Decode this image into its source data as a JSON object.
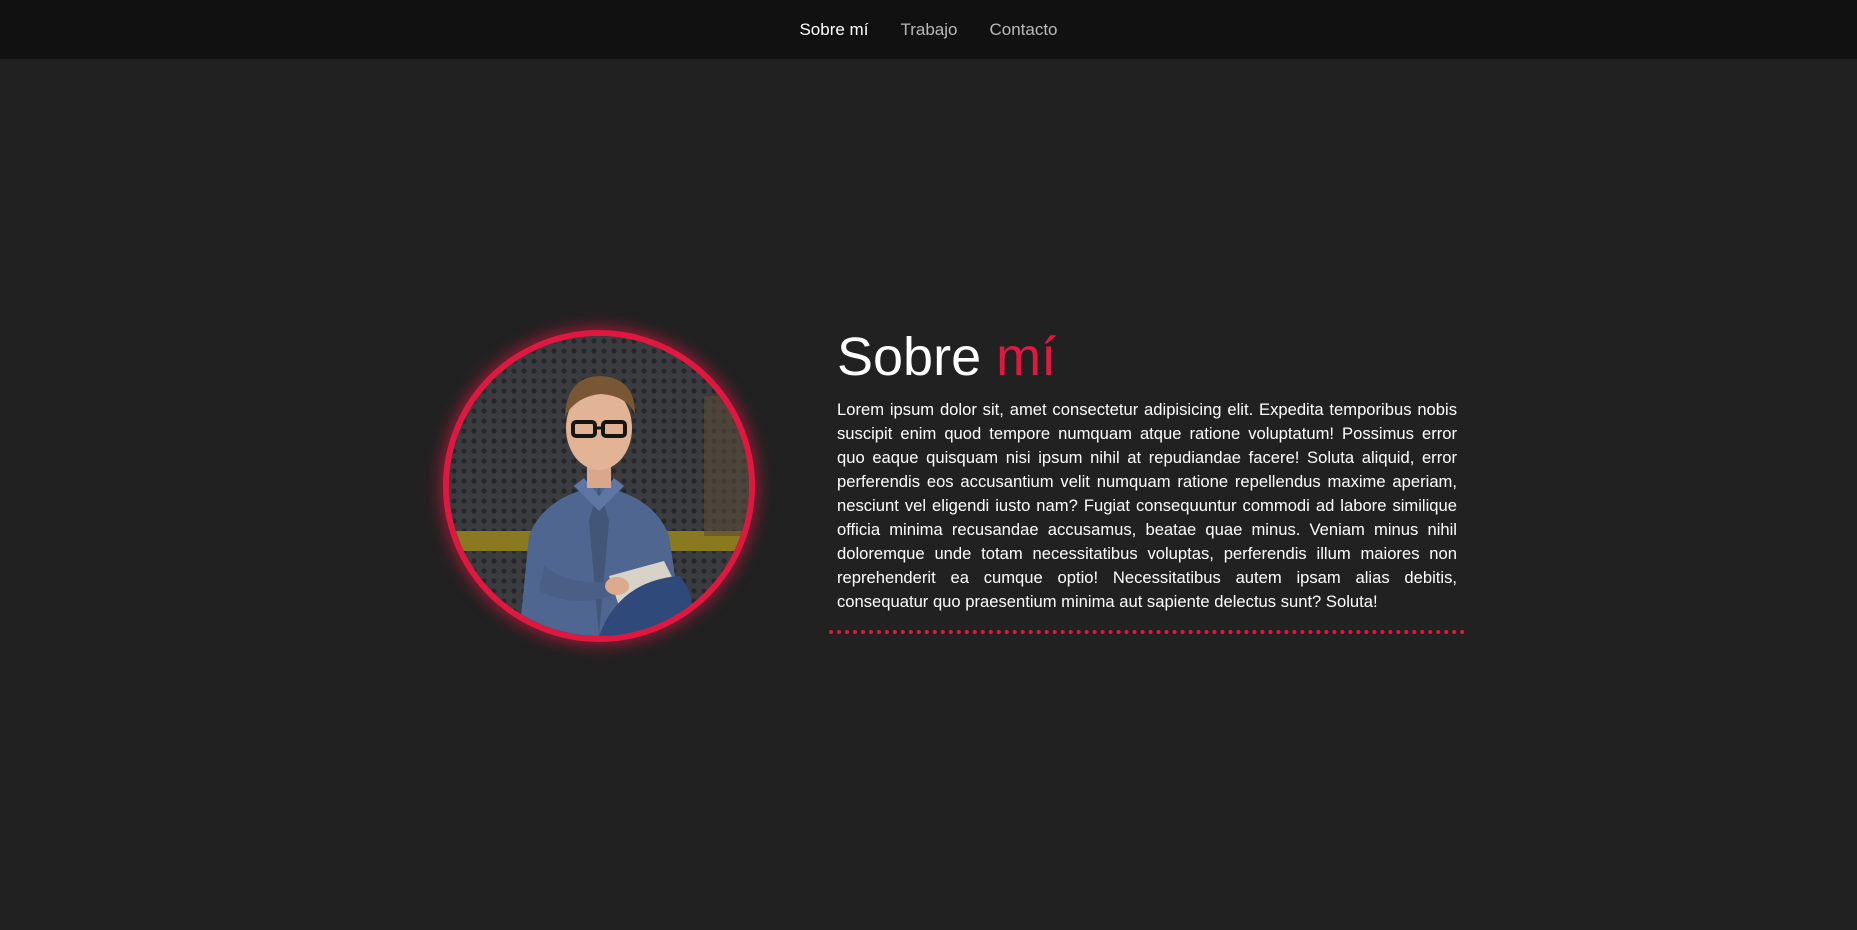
{
  "nav": {
    "items": [
      {
        "label": "Sobre mí",
        "active": true
      },
      {
        "label": "Trabajo",
        "active": false
      },
      {
        "label": "Contacto",
        "active": false
      }
    ]
  },
  "about": {
    "title_main": "Sobre",
    "title_accent": "mí",
    "paragraph": "Lorem ipsum dolor sit, amet consectetur adipisicing elit. Expedita temporibus nobis suscipit enim quod tempore numquam atque ratione voluptatum! Possimus error quo eaque quisquam nisi ipsum nihil at repudiandae facere! Soluta aliquid, error perferendis eos accusantium velit numquam ratione repellendus maxime aperiam, nesciunt vel eligendi iusto nam? Fugiat consequuntur commodi ad labore similique officia minima recusandae accusamus, beatae quae minus. Veniam minus nihil doloremque unde totam necessitatibus voluptas, perferendis illum maiores non reprehenderit ea cumque optio! Necessitatibus autem ipsam alias debitis, consequatur quo praesentium minima aut sapiente delectus sunt? Soluta!"
  },
  "colors": {
    "accent": "#e0173f",
    "background": "#222122",
    "navbar": "#121112"
  },
  "icons": {
    "profile_photo": "profile-photo"
  }
}
